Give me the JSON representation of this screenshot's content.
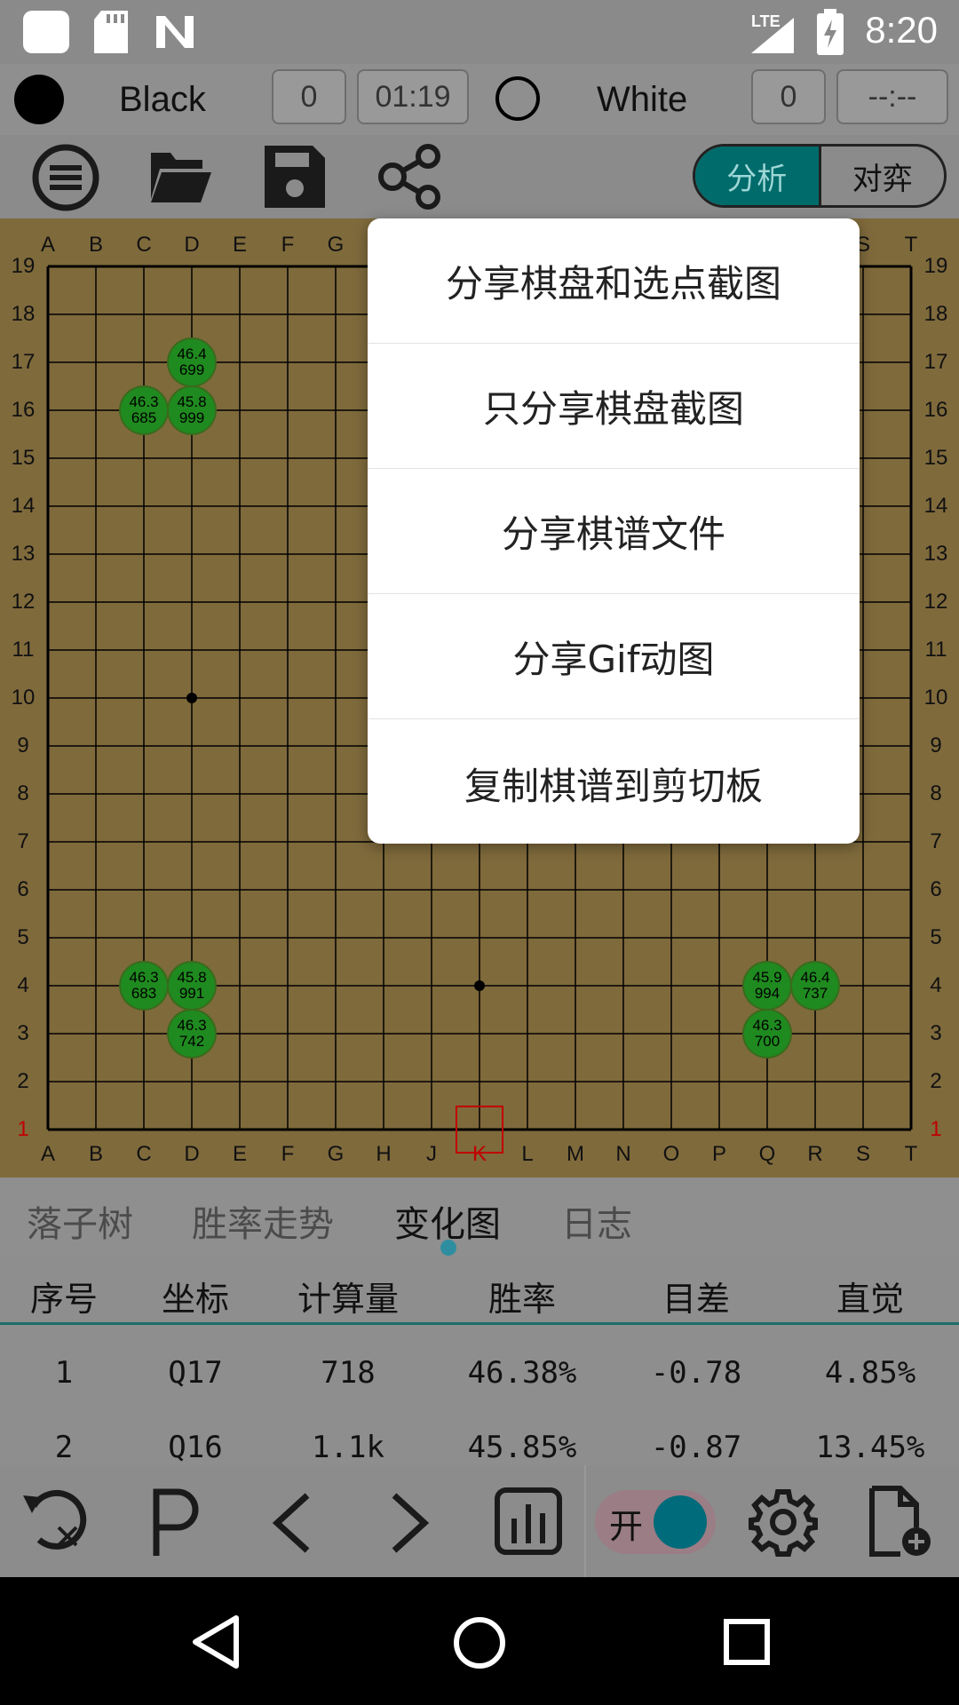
{
  "status_bar": {
    "time": "8:20",
    "network": "LTE"
  },
  "players": {
    "black": {
      "name": "Black",
      "captures": "0",
      "clock": "01:19"
    },
    "white": {
      "name": "White",
      "captures": "0",
      "clock": "--:--"
    }
  },
  "mode_toggle": {
    "analysis": "分析",
    "play": "对弈",
    "selected": "analysis"
  },
  "board": {
    "size": 19,
    "columns": [
      "A",
      "B",
      "C",
      "D",
      "E",
      "F",
      "G",
      "H",
      "J",
      "K",
      "L",
      "M",
      "N",
      "O",
      "P",
      "Q",
      "R",
      "S",
      "T"
    ],
    "rows": [
      "19",
      "18",
      "17",
      "16",
      "15",
      "14",
      "13",
      "12",
      "11",
      "10",
      "9",
      "8",
      "7",
      "6",
      "5",
      "4",
      "3",
      "2",
      "1"
    ],
    "candidates": [
      {
        "point": "D17",
        "winrate": "46.4",
        "visits": "699"
      },
      {
        "point": "C16",
        "winrate": "46.3",
        "visits": "685"
      },
      {
        "point": "D16",
        "winrate": "45.8",
        "visits": "999"
      },
      {
        "point": "C4",
        "winrate": "46.3",
        "visits": "683"
      },
      {
        "point": "D4",
        "winrate": "45.8",
        "visits": "991"
      },
      {
        "point": "D3",
        "winrate": "46.3",
        "visits": "742"
      },
      {
        "point": "Q4",
        "winrate": "45.9",
        "visits": "994"
      },
      {
        "point": "R4",
        "winrate": "46.4",
        "visits": "737"
      },
      {
        "point": "Q3",
        "winrate": "46.3",
        "visits": "700"
      }
    ],
    "cursor": "K1"
  },
  "share_menu": {
    "items": [
      "分享棋盘和选点截图",
      "只分享棋盘截图",
      "分享棋谱文件",
      "分享Gif动图",
      "复制棋谱到剪切板"
    ]
  },
  "tabs": {
    "items": [
      "落子树",
      "胜率走势",
      "变化图",
      "日志"
    ],
    "active": 2
  },
  "table": {
    "headers": [
      "序号",
      "坐标",
      "计算量",
      "胜率",
      "目差",
      "直觉"
    ],
    "rows": [
      [
        "1",
        "Q17",
        "718",
        "46.38%",
        "-0.78",
        "4.85%"
      ],
      [
        "2",
        "Q16",
        "1.1k",
        "45.85%",
        "-0.87",
        "13.45%"
      ]
    ]
  },
  "engine_toggle": {
    "label": "开"
  },
  "colors": {
    "accent": "#006b6b",
    "candidate": "#1f8a1f",
    "board": "#7f6a3c",
    "cursor": "#c00000"
  }
}
